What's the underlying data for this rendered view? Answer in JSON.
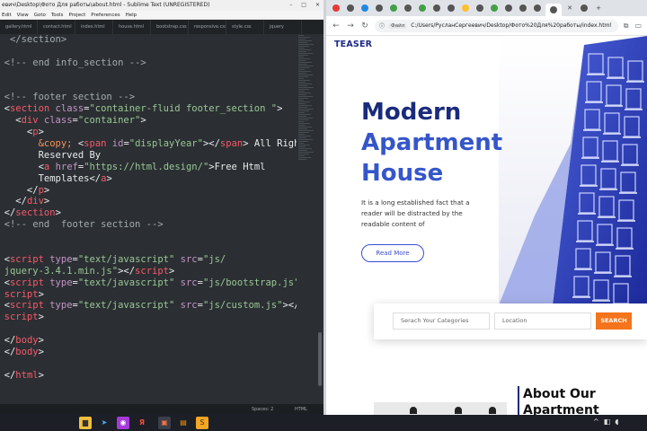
{
  "sublime": {
    "title": "евич\\Desktop\\Фото Для работы\\about.html - Sublime Text (UNREGISTERED)",
    "menu": [
      "Edit",
      "View",
      "Goto",
      "Tools",
      "Project",
      "Preferences",
      "Help"
    ],
    "tabs": [
      "gallery.html",
      "contact.html",
      "index.html",
      "house.html",
      "bootstrap.css",
      "responsive.css",
      "style.css",
      "jquery"
    ],
    "status_left": "Spaces: 2",
    "status_right": "HTML",
    "code": [
      [
        {
          "t": "   </section>",
          "c": "c-com"
        }
      ],
      [
        {
          "t": "",
          "c": "c-txt"
        }
      ],
      [
        {
          "t": "  <!-- end info_section -->",
          "c": "c-com"
        }
      ],
      [
        {
          "t": "",
          "c": "c-txt"
        }
      ],
      [
        {
          "t": "",
          "c": "c-txt"
        }
      ],
      [
        {
          "t": "  <!-- footer section -->",
          "c": "c-com"
        }
      ],
      [
        {
          "t": "  <",
          "c": "c-txt"
        },
        {
          "t": "section ",
          "c": "c-tag"
        },
        {
          "t": "class",
          "c": "c-attr"
        },
        {
          "t": "=",
          "c": "c-txt"
        },
        {
          "t": "\"container-fluid footer_section \"",
          "c": "c-str"
        },
        {
          "t": ">",
          "c": "c-txt"
        }
      ],
      [
        {
          "t": "    <",
          "c": "c-txt"
        },
        {
          "t": "div ",
          "c": "c-tag"
        },
        {
          "t": "class",
          "c": "c-attr"
        },
        {
          "t": "=",
          "c": "c-txt"
        },
        {
          "t": "\"container\"",
          "c": "c-str"
        },
        {
          "t": ">",
          "c": "c-txt"
        }
      ],
      [
        {
          "t": "      <",
          "c": "c-txt"
        },
        {
          "t": "p",
          "c": "c-tag"
        },
        {
          "t": ">",
          "c": "c-txt"
        }
      ],
      [
        {
          "t": "        ",
          "c": "c-txt"
        },
        {
          "t": "&copy;",
          "c": "c-ent"
        },
        {
          "t": " <",
          "c": "c-txt"
        },
        {
          "t": "span ",
          "c": "c-tag"
        },
        {
          "t": "id",
          "c": "c-attr"
        },
        {
          "t": "=",
          "c": "c-txt"
        },
        {
          "t": "\"displayYear\"",
          "c": "c-str"
        },
        {
          "t": "></",
          "c": "c-txt"
        },
        {
          "t": "span",
          "c": "c-tag"
        },
        {
          "t": "> All Rights",
          "c": "c-txt"
        }
      ],
      [
        {
          "t": "        Reserved By",
          "c": "c-txt"
        }
      ],
      [
        {
          "t": "        <",
          "c": "c-txt"
        },
        {
          "t": "a ",
          "c": "c-tag"
        },
        {
          "t": "href",
          "c": "c-attr"
        },
        {
          "t": "=",
          "c": "c-txt"
        },
        {
          "t": "\"https://html.design/\"",
          "c": "c-str"
        },
        {
          "t": ">Free Html",
          "c": "c-txt"
        }
      ],
      [
        {
          "t": "        Templates</",
          "c": "c-txt"
        },
        {
          "t": "a",
          "c": "c-tag"
        },
        {
          "t": ">",
          "c": "c-txt"
        }
      ],
      [
        {
          "t": "      </",
          "c": "c-txt"
        },
        {
          "t": "p",
          "c": "c-tag"
        },
        {
          "t": ">",
          "c": "c-txt"
        }
      ],
      [
        {
          "t": "    </",
          "c": "c-txt"
        },
        {
          "t": "div",
          "c": "c-tag"
        },
        {
          "t": ">",
          "c": "c-txt"
        }
      ],
      [
        {
          "t": "  </",
          "c": "c-txt"
        },
        {
          "t": "section",
          "c": "c-tag"
        },
        {
          "t": ">",
          "c": "c-txt"
        }
      ],
      [
        {
          "t": "  <!-- end  footer section -->",
          "c": "c-com"
        }
      ],
      [
        {
          "t": "",
          "c": "c-txt"
        }
      ],
      [
        {
          "t": "",
          "c": "c-txt"
        }
      ],
      [
        {
          "t": "  <",
          "c": "c-txt"
        },
        {
          "t": "script ",
          "c": "c-tag"
        },
        {
          "t": "type",
          "c": "c-attr"
        },
        {
          "t": "=",
          "c": "c-txt"
        },
        {
          "t": "\"text/javascript\"",
          "c": "c-str"
        },
        {
          "t": " ",
          "c": "c-txt"
        },
        {
          "t": "src",
          "c": "c-attr"
        },
        {
          "t": "=",
          "c": "c-txt"
        },
        {
          "t": "\"js/",
          "c": "c-str"
        }
      ],
      [
        {
          "t": "  jquery-3.4.1.min.js\"",
          "c": "c-str"
        },
        {
          "t": "></",
          "c": "c-txt"
        },
        {
          "t": "script",
          "c": "c-tag"
        },
        {
          "t": ">",
          "c": "c-txt"
        }
      ],
      [
        {
          "t": "  <",
          "c": "c-txt"
        },
        {
          "t": "script ",
          "c": "c-tag"
        },
        {
          "t": "type",
          "c": "c-attr"
        },
        {
          "t": "=",
          "c": "c-txt"
        },
        {
          "t": "\"text/javascript\"",
          "c": "c-str"
        },
        {
          "t": " ",
          "c": "c-txt"
        },
        {
          "t": "src",
          "c": "c-attr"
        },
        {
          "t": "=",
          "c": "c-txt"
        },
        {
          "t": "\"js/bootstrap.js\"",
          "c": "c-str"
        },
        {
          "t": "></",
          "c": "c-txt"
        }
      ],
      [
        {
          "t": "  script",
          "c": "c-tag"
        },
        {
          "t": ">",
          "c": "c-txt"
        }
      ],
      [
        {
          "t": "  <",
          "c": "c-txt"
        },
        {
          "t": "script ",
          "c": "c-tag"
        },
        {
          "t": "type",
          "c": "c-attr"
        },
        {
          "t": "=",
          "c": "c-txt"
        },
        {
          "t": "\"text/javascript\"",
          "c": "c-str"
        },
        {
          "t": " ",
          "c": "c-txt"
        },
        {
          "t": "src",
          "c": "c-attr"
        },
        {
          "t": "=",
          "c": "c-txt"
        },
        {
          "t": "\"js/custom.js\"",
          "c": "c-str"
        },
        {
          "t": "></",
          "c": "c-txt"
        }
      ],
      [
        {
          "t": "  script",
          "c": "c-tag"
        },
        {
          "t": ">",
          "c": "c-txt"
        }
      ],
      [
        {
          "t": "",
          "c": "c-txt"
        }
      ],
      [
        {
          "t": "  </",
          "c": "c-txt"
        },
        {
          "t": "body",
          "c": "c-tag"
        },
        {
          "t": ">",
          "c": "c-txt"
        }
      ],
      [
        {
          "t": "  </",
          "c": "c-txt"
        },
        {
          "t": "body",
          "c": "c-tag"
        },
        {
          "t": ">",
          "c": "c-txt"
        }
      ],
      [
        {
          "t": "",
          "c": "c-txt"
        }
      ],
      [
        {
          "t": "  </",
          "c": "c-txt"
        },
        {
          "t": "html",
          "c": "c-tag"
        },
        {
          "t": ">",
          "c": "c-txt"
        }
      ]
    ]
  },
  "chrome": {
    "url_chip": "Файл",
    "url": "C:/Users/РусланСергеевич/Desktop/Фото%20Для%20работы/index.html",
    "page": {
      "logo": "TEASER",
      "title_line1": "Modern",
      "title_line2": "Apartment",
      "title_line3": "House",
      "description": "It is a long established fact that a reader will be distracted by the readable content of",
      "read_more": "Read More",
      "search_category_placeholder": "Serach Your Categories",
      "search_location_placeholder": "Location",
      "search_button": "SEARCH",
      "about_title": "About Our Apartment"
    }
  },
  "colors": {
    "brand_dark": "#1a2b7c",
    "brand_blue": "#3556c9",
    "accent_orange": "#f5741b"
  }
}
